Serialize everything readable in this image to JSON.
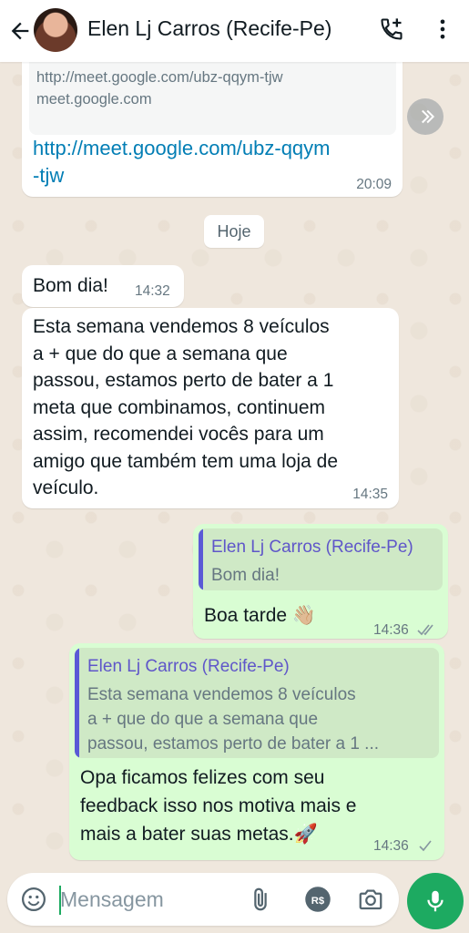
{
  "header": {
    "contact_name": "Elen Lj Carros (Recife-Pe)"
  },
  "messages": {
    "link_preview": {
      "url": "http://meet.google.com/ubz-qqym-tjw",
      "domain": "meet.google.com",
      "link_line1": "http://meet.google.com/ubz-qqym",
      "link_line2": "-tjw",
      "time": "20:09"
    },
    "date_separator": "Hoje",
    "msg1": {
      "text": "Bom dia!",
      "time": "14:32"
    },
    "msg2": {
      "lines": [
        "Esta semana vendemos 8 veículos",
        "a + que do que a semana que",
        "passou, estamos perto de bater a 1",
        "meta que combinamos, continuem",
        "assim, recomendei vocês para um",
        "amigo que também tem uma loja de",
        "veículo."
      ],
      "time": "14:35"
    },
    "reply1": {
      "quote_name": "Elen Lj Carros (Recife-Pe)",
      "quote_text": "Bom dia!",
      "text": "Boa tarde",
      "emoji": "👋🏼",
      "time": "14:36"
    },
    "reply2": {
      "quote_name": "Elen Lj Carros (Recife-Pe)",
      "quote_lines": [
        "Esta semana vendemos 8 veículos",
        "a + que do que a semana que",
        "passou, estamos perto de bater a 1 ..."
      ],
      "lines": [
        "Opa ficamos felizes com seu",
        "feedback isso nos motiva mais e",
        "mais a bater suas metas."
      ],
      "emoji": "🚀",
      "time": "14:36"
    }
  },
  "composer": {
    "placeholder": "Mensagem"
  },
  "colors": {
    "accent_green": "#1daa61",
    "outgoing_bubble": "#d9fdd3",
    "quote_name": "#5f56c9",
    "link": "#027eb5"
  }
}
